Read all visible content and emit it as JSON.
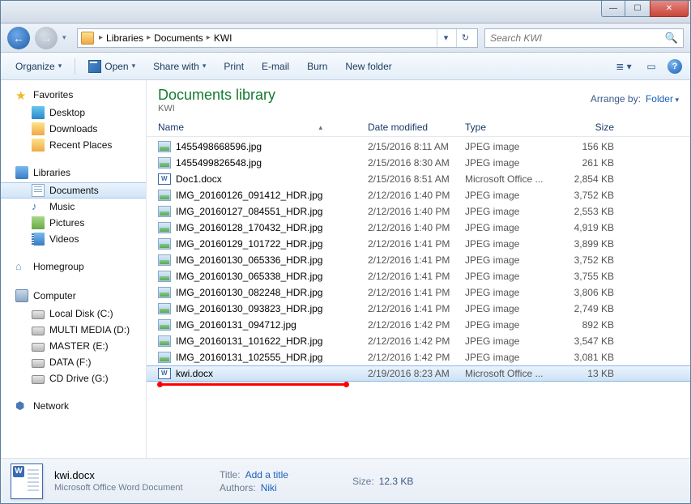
{
  "breadcrumbs": [
    "Libraries",
    "Documents",
    "KWI"
  ],
  "search_placeholder": "Search KWI",
  "toolbar": {
    "organize": "Organize",
    "open": "Open",
    "share": "Share with",
    "print": "Print",
    "email": "E-mail",
    "burn": "Burn",
    "newfolder": "New folder"
  },
  "sidebar": {
    "favorites": "Favorites",
    "desktop": "Desktop",
    "downloads": "Downloads",
    "recent": "Recent Places",
    "libraries": "Libraries",
    "documents": "Documents",
    "music": "Music",
    "pictures": "Pictures",
    "videos": "Videos",
    "homegroup": "Homegroup",
    "computer": "Computer",
    "localC": "Local Disk (C:)",
    "multiD": "MULTI MEDIA (D:)",
    "masterE": "MASTER (E:)",
    "dataF": "DATA (F:)",
    "cdG": "CD Drive (G:)",
    "network": "Network"
  },
  "library": {
    "title": "Documents library",
    "sub": "KWI",
    "arrange_label": "Arrange by:",
    "arrange_value": "Folder"
  },
  "columns": {
    "name": "Name",
    "date": "Date modified",
    "type": "Type",
    "size": "Size"
  },
  "files": [
    {
      "icon": "img",
      "name": "1455498668596.jpg",
      "date": "2/15/2016 8:11 AM",
      "type": "JPEG image",
      "size": "156 KB",
      "sel": false
    },
    {
      "icon": "img",
      "name": "1455499826548.jpg",
      "date": "2/15/2016 8:30 AM",
      "type": "JPEG image",
      "size": "261 KB",
      "sel": false
    },
    {
      "icon": "docx",
      "name": "Doc1.docx",
      "date": "2/15/2016 8:51 AM",
      "type": "Microsoft Office ...",
      "size": "2,854 KB",
      "sel": false
    },
    {
      "icon": "img",
      "name": "IMG_20160126_091412_HDR.jpg",
      "date": "2/12/2016 1:40 PM",
      "type": "JPEG image",
      "size": "3,752 KB",
      "sel": false
    },
    {
      "icon": "img",
      "name": "IMG_20160127_084551_HDR.jpg",
      "date": "2/12/2016 1:40 PM",
      "type": "JPEG image",
      "size": "2,553 KB",
      "sel": false
    },
    {
      "icon": "img",
      "name": "IMG_20160128_170432_HDR.jpg",
      "date": "2/12/2016 1:40 PM",
      "type": "JPEG image",
      "size": "4,919 KB",
      "sel": false
    },
    {
      "icon": "img",
      "name": "IMG_20160129_101722_HDR.jpg",
      "date": "2/12/2016 1:41 PM",
      "type": "JPEG image",
      "size": "3,899 KB",
      "sel": false
    },
    {
      "icon": "img",
      "name": "IMG_20160130_065336_HDR.jpg",
      "date": "2/12/2016 1:41 PM",
      "type": "JPEG image",
      "size": "3,752 KB",
      "sel": false
    },
    {
      "icon": "img",
      "name": "IMG_20160130_065338_HDR.jpg",
      "date": "2/12/2016 1:41 PM",
      "type": "JPEG image",
      "size": "3,755 KB",
      "sel": false
    },
    {
      "icon": "img",
      "name": "IMG_20160130_082248_HDR.jpg",
      "date": "2/12/2016 1:41 PM",
      "type": "JPEG image",
      "size": "3,806 KB",
      "sel": false
    },
    {
      "icon": "img",
      "name": "IMG_20160130_093823_HDR.jpg",
      "date": "2/12/2016 1:41 PM",
      "type": "JPEG image",
      "size": "2,749 KB",
      "sel": false
    },
    {
      "icon": "img",
      "name": "IMG_20160131_094712.jpg",
      "date": "2/12/2016 1:42 PM",
      "type": "JPEG image",
      "size": "892 KB",
      "sel": false
    },
    {
      "icon": "img",
      "name": "IMG_20160131_101622_HDR.jpg",
      "date": "2/12/2016 1:42 PM",
      "type": "JPEG image",
      "size": "3,547 KB",
      "sel": false
    },
    {
      "icon": "img",
      "name": "IMG_20160131_102555_HDR.jpg",
      "date": "2/12/2016 1:42 PM",
      "type": "JPEG image",
      "size": "3,081 KB",
      "sel": false
    },
    {
      "icon": "docx",
      "name": "kwi.docx",
      "date": "2/19/2016 8:23 AM",
      "type": "Microsoft Office ...",
      "size": "13 KB",
      "sel": true
    }
  ],
  "details": {
    "name": "kwi.docx",
    "kind": "Microsoft Office Word Document",
    "title_label": "Title:",
    "title_value": "Add a title",
    "authors_label": "Authors:",
    "authors_value": "Niki",
    "size_label": "Size:",
    "size_value": "12.3 KB"
  }
}
